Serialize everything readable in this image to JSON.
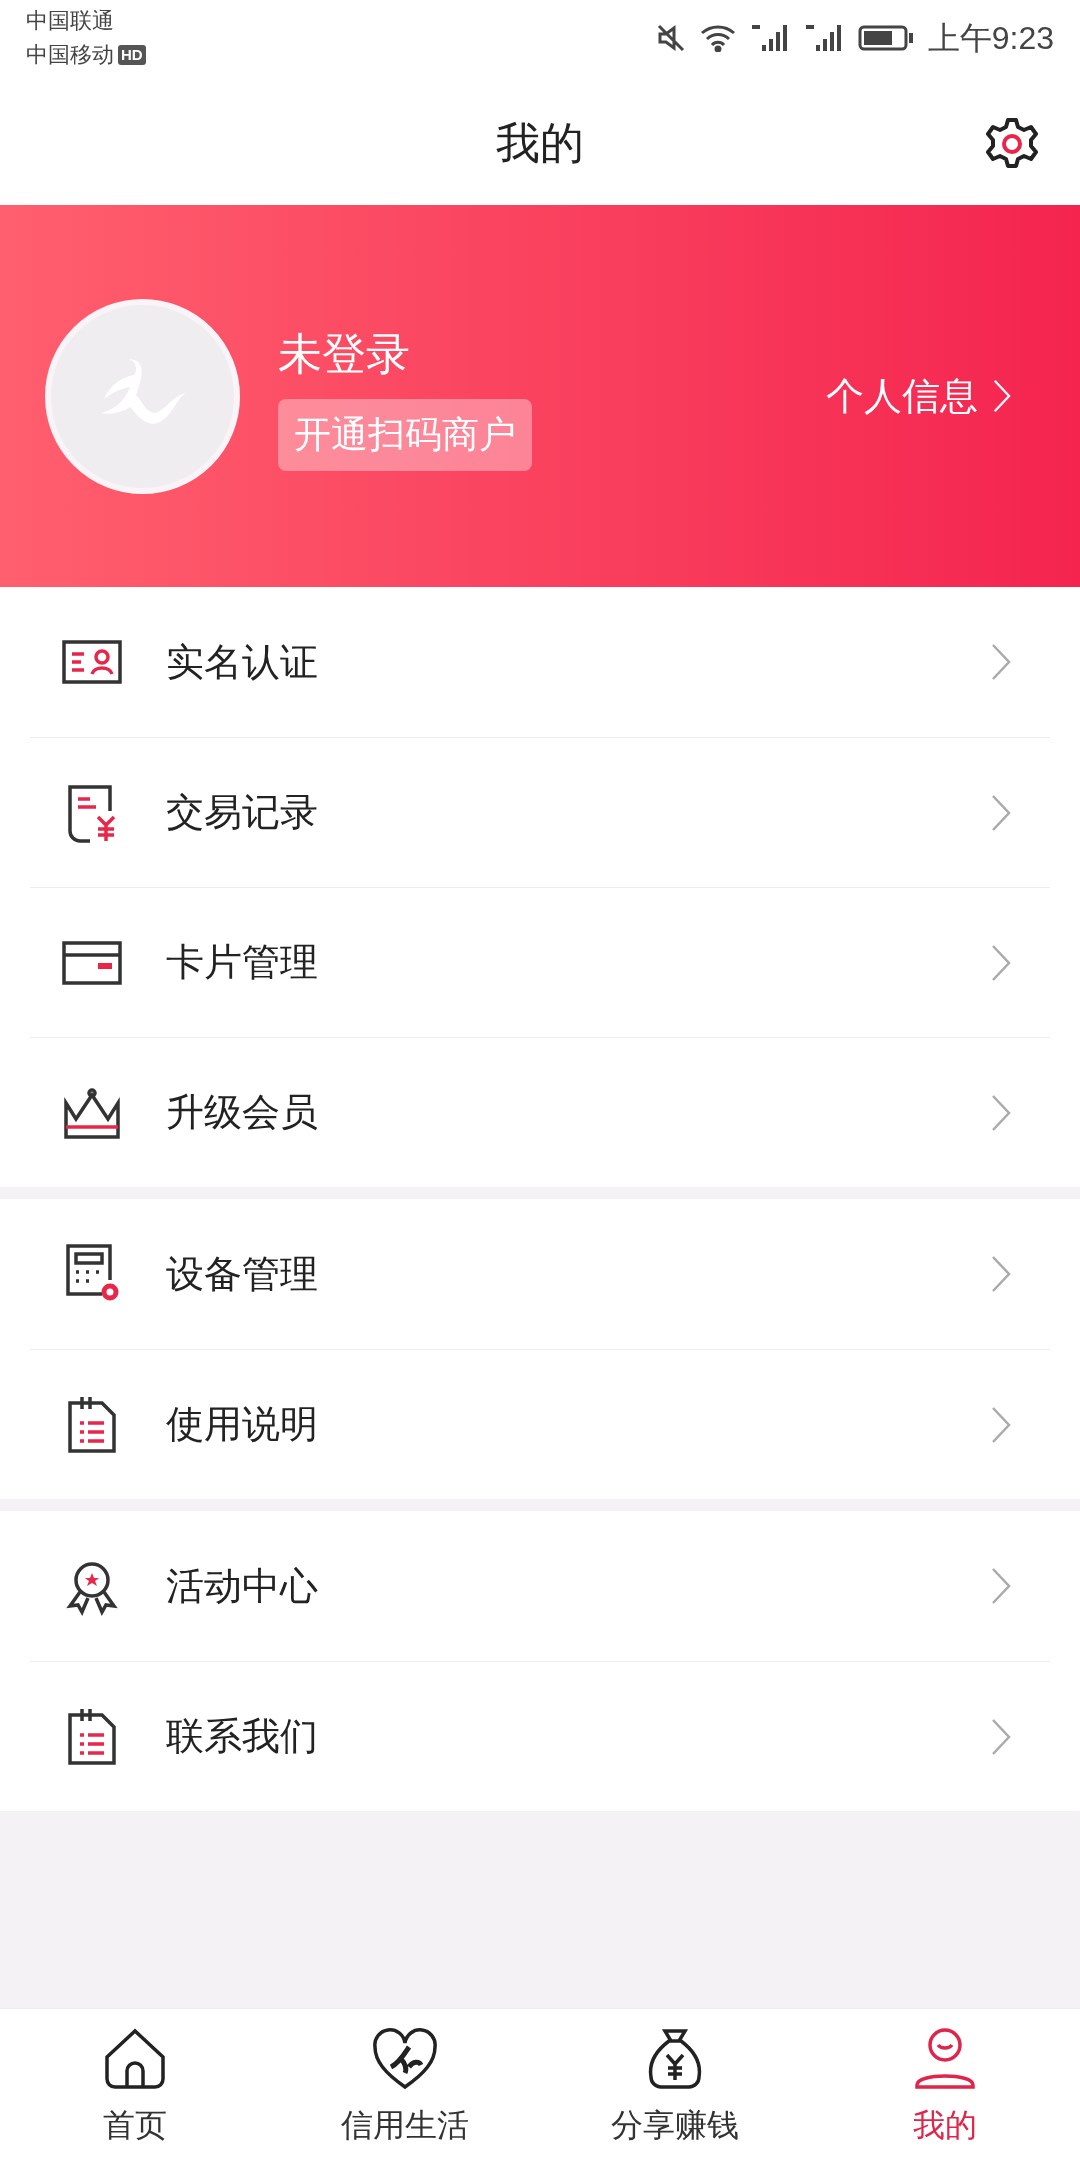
{
  "status_bar": {
    "carrier_1": "中国联通",
    "carrier_2": "中国移动",
    "hd_badge": "HD",
    "time": "上午9:23"
  },
  "header": {
    "title": "我的"
  },
  "profile": {
    "name": "未登录",
    "merchant_button": "开通扫码商户",
    "info_link": "个人信息"
  },
  "menu_groups": [
    {
      "items": [
        {
          "label": "实名认证",
          "kind": "idcard"
        },
        {
          "label": "交易记录",
          "kind": "receipt"
        },
        {
          "label": "卡片管理",
          "kind": "card"
        },
        {
          "label": "升级会员",
          "kind": "crown"
        }
      ]
    },
    {
      "items": [
        {
          "label": "设备管理",
          "kind": "device"
        },
        {
          "label": "使用说明",
          "kind": "notes"
        }
      ]
    },
    {
      "items": [
        {
          "label": "活动中心",
          "kind": "medal"
        },
        {
          "label": "联系我们",
          "kind": "notes"
        }
      ]
    }
  ],
  "tab_bar": [
    {
      "label": "首页",
      "kind": "home",
      "selected": false
    },
    {
      "label": "信用生活",
      "kind": "heart",
      "selected": false
    },
    {
      "label": "分享赚钱",
      "kind": "moneybag",
      "selected": false
    },
    {
      "label": "我的",
      "kind": "person",
      "selected": true
    }
  ]
}
